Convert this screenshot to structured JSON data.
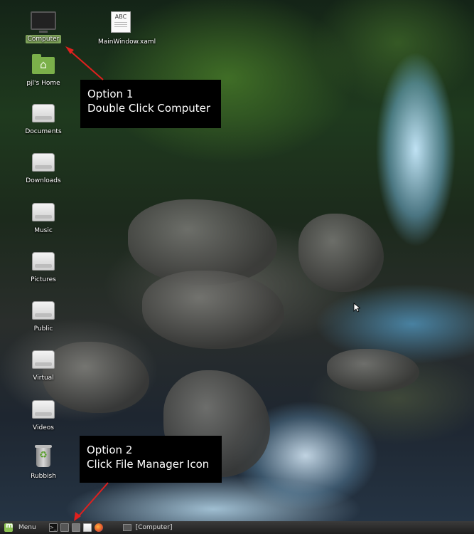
{
  "desktop": {
    "icons": [
      {
        "label": "Computer",
        "icon": "computer-icon",
        "selected": true
      },
      {
        "label": "MainWindow.xaml",
        "icon": "document-icon",
        "doc_text": "ABC"
      },
      {
        "label": "pjl's Home",
        "icon": "home-folder-icon"
      },
      {
        "label": "Documents",
        "icon": "drive-icon"
      },
      {
        "label": "Downloads",
        "icon": "drive-icon"
      },
      {
        "label": "Music",
        "icon": "drive-icon"
      },
      {
        "label": "Pictures",
        "icon": "drive-icon"
      },
      {
        "label": "Public",
        "icon": "drive-icon"
      },
      {
        "label": "Virtual",
        "icon": "drive-icon"
      },
      {
        "label": "Videos",
        "icon": "drive-icon"
      },
      {
        "label": "Rubbish",
        "icon": "trash-icon"
      }
    ]
  },
  "annotations": {
    "option1": {
      "line1": "Option 1",
      "line2": "Double Click Computer"
    },
    "option2": {
      "line1": "Option 2",
      "line2": "Click File Manager Icon"
    },
    "arrow_color": "#e0201e"
  },
  "taskbar": {
    "menu_label": "Menu",
    "terminal_glyph": ">_",
    "window_label": "[Computer]"
  },
  "colors": {
    "selected_label_bg": "#7fa35a",
    "menu_logo": "#8cc152"
  }
}
